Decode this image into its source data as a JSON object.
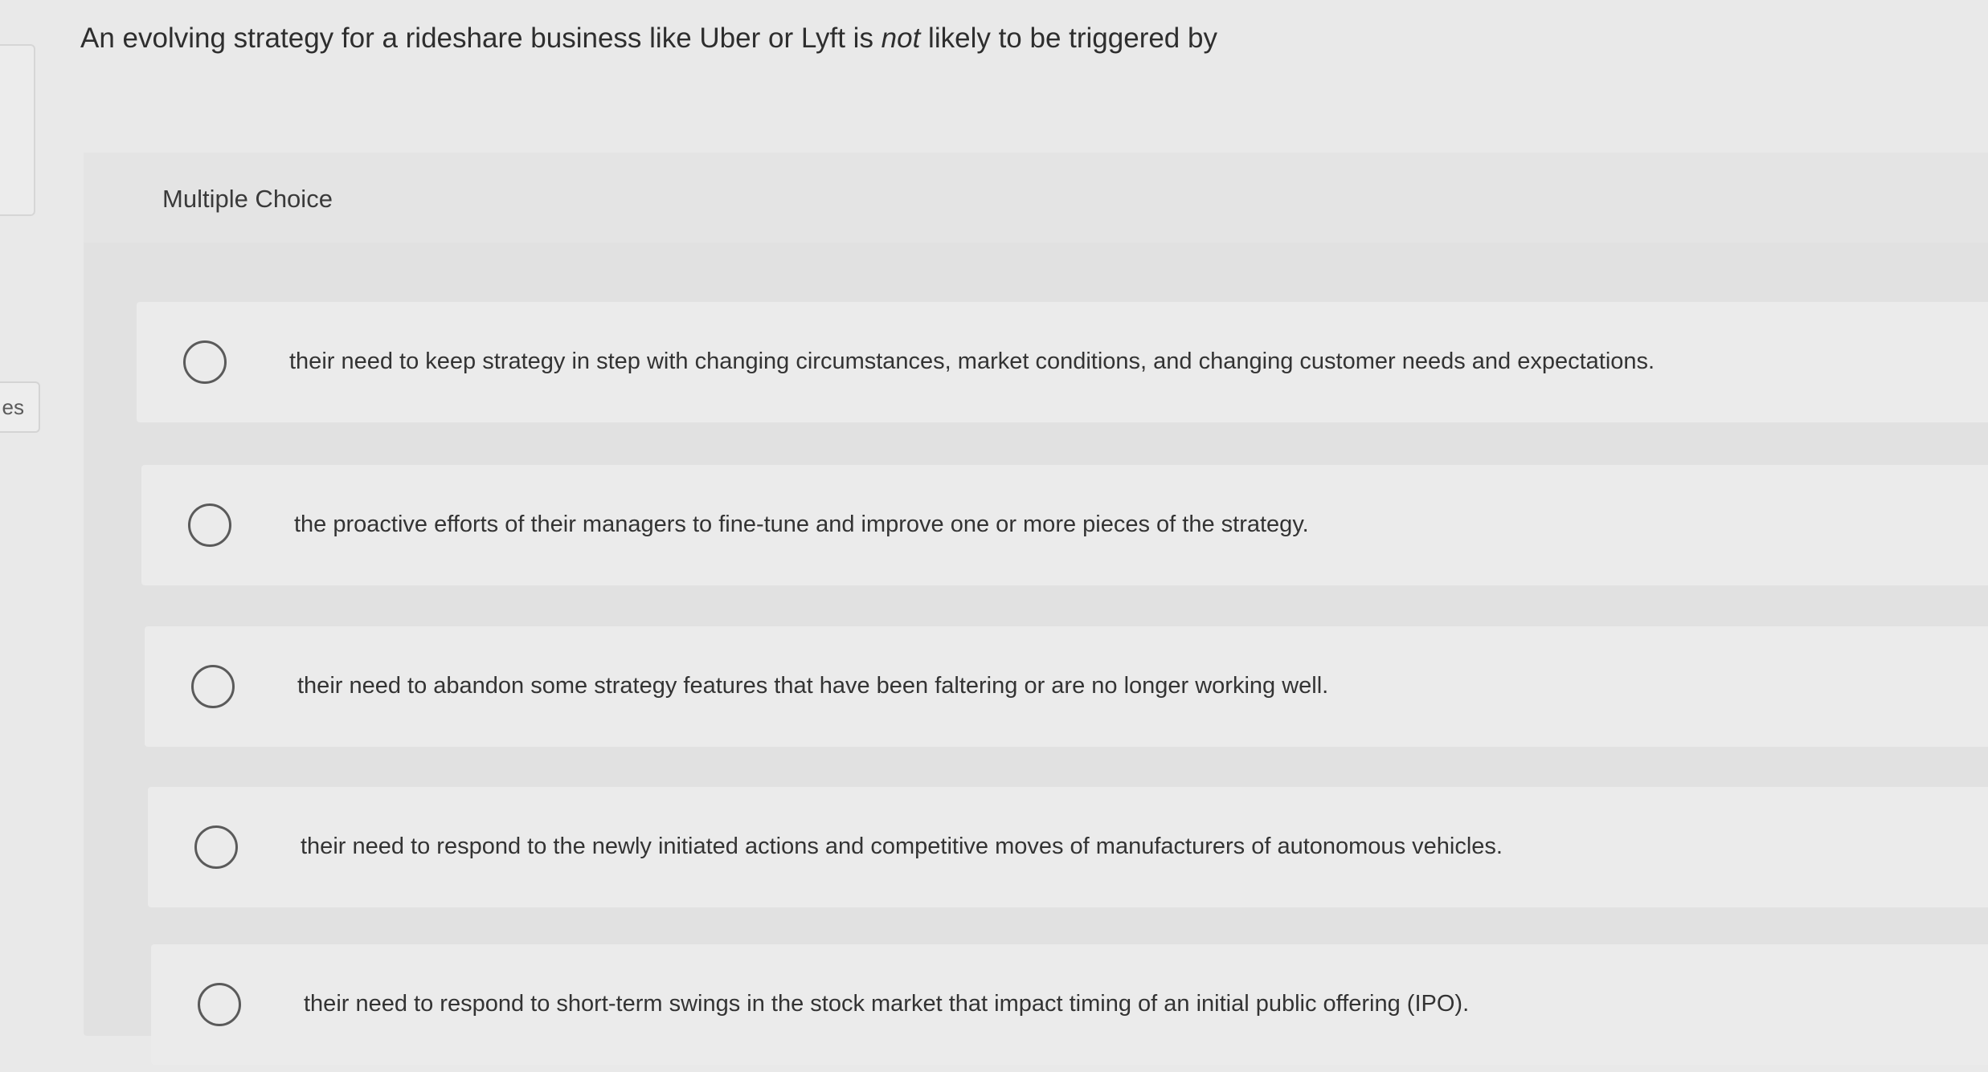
{
  "left_tab": {
    "label": "es"
  },
  "question": {
    "before": "An evolving strategy for a rideshare business like Uber or Lyft is ",
    "emphasis": "not",
    "after": " likely to be triggered by"
  },
  "panel": {
    "label": "Multiple Choice"
  },
  "options": [
    {
      "text": "their need to keep strategy in step with changing circumstances, market conditions, and changing customer needs and expectations."
    },
    {
      "text": "the proactive efforts of their managers to fine-tune and improve one or more pieces of the strategy."
    },
    {
      "text": "their need to abandon some strategy features that have been faltering or are no longer working well."
    },
    {
      "text": "their need to respond to the newly initiated actions and competitive moves of manufacturers of autonomous vehicles."
    },
    {
      "text": "their need to respond to short-term swings in the stock market that impact timing of an initial public offering (IPO)."
    }
  ]
}
